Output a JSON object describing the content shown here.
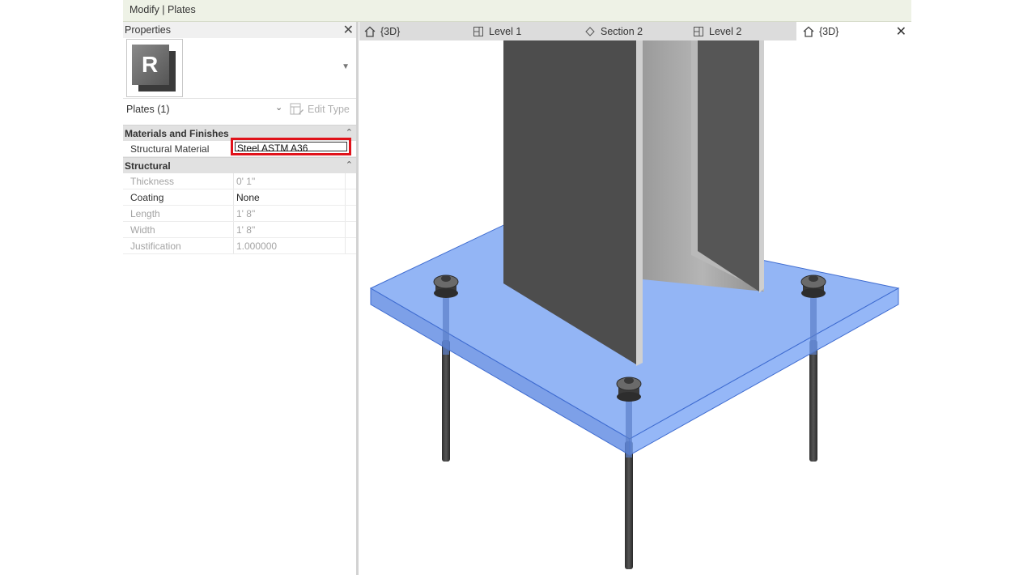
{
  "title": "Modify | Plates",
  "properties": {
    "title": "Properties",
    "selection": "Plates (1)",
    "edit_type": "Edit Type",
    "categories": [
      {
        "name": "Materials and Finishes",
        "rows": [
          {
            "name": "Structural Material",
            "value": "Steel ASTM A36",
            "editable": true
          }
        ]
      },
      {
        "name": "Structural",
        "rows": [
          {
            "name": "Thickness",
            "value": "0'  1\"",
            "editable": false
          },
          {
            "name": "Coating",
            "value": "None",
            "editable": true
          },
          {
            "name": "Length",
            "value": "1'  8\"",
            "editable": false
          },
          {
            "name": "Width",
            "value": "1'  8\"",
            "editable": false
          },
          {
            "name": "Justification",
            "value": "1.000000",
            "editable": false
          }
        ]
      }
    ]
  },
  "tabs": [
    {
      "label": "{3D}",
      "icon": "home-icon",
      "active": false
    },
    {
      "label": "Level 1",
      "icon": "floor-plan-icon",
      "active": false
    },
    {
      "label": "Section 2",
      "icon": "section-icon",
      "active": false
    },
    {
      "label": "Level 2",
      "icon": "floor-plan-icon",
      "active": false
    },
    {
      "label": "{3D}",
      "icon": "home-icon",
      "active": true
    }
  ],
  "colors": {
    "plate": "#6f9cf2",
    "highlight": "#e0121a",
    "steel": "#4d4d4d"
  }
}
